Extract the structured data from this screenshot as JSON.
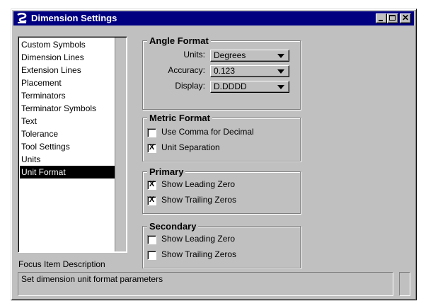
{
  "window": {
    "title": "Dimension Settings",
    "icons": {
      "app": "microstation-icon",
      "minimize": "minimize-icon",
      "maximize": "maximize-icon",
      "close": "close-icon"
    },
    "close_glyph": "✕"
  },
  "categories": {
    "items": [
      {
        "label": "Custom Symbols",
        "selected": false
      },
      {
        "label": "Dimension Lines",
        "selected": false
      },
      {
        "label": "Extension Lines",
        "selected": false
      },
      {
        "label": "Placement",
        "selected": false
      },
      {
        "label": "Terminators",
        "selected": false
      },
      {
        "label": "Terminator Symbols",
        "selected": false
      },
      {
        "label": "Text",
        "selected": false
      },
      {
        "label": "Tolerance",
        "selected": false
      },
      {
        "label": "Tool Settings",
        "selected": false
      },
      {
        "label": "Units",
        "selected": false
      },
      {
        "label": "Unit Format",
        "selected": true
      }
    ]
  },
  "angle_format": {
    "title": "Angle Format",
    "units": {
      "label": "Units:",
      "value": "Degrees"
    },
    "accuracy": {
      "label": "Accuracy:",
      "value": "0.123"
    },
    "display": {
      "label": "Display:",
      "value": "D.DDDD"
    }
  },
  "metric_format": {
    "title": "Metric Format",
    "use_comma": {
      "label": "Use Comma for Decimal",
      "checked": false
    },
    "unit_separation": {
      "label": "Unit Separation",
      "checked": true
    }
  },
  "primary": {
    "title": "Primary",
    "leading_zero": {
      "label": "Show Leading Zero",
      "checked": true
    },
    "trailing_zeros": {
      "label": "Show Trailing Zeros",
      "checked": true
    }
  },
  "secondary": {
    "title": "Secondary",
    "leading_zero": {
      "label": "Show Leading Zero",
      "checked": false
    },
    "trailing_zeros": {
      "label": "Show Trailing Zeros",
      "checked": false
    }
  },
  "focus": {
    "label": "Focus Item Description",
    "description": "Set dimension unit format parameters"
  },
  "check_mark": "X",
  "colors": {
    "titlebar": "#000080",
    "face": "#c0c0c0",
    "selection": "#000000"
  }
}
